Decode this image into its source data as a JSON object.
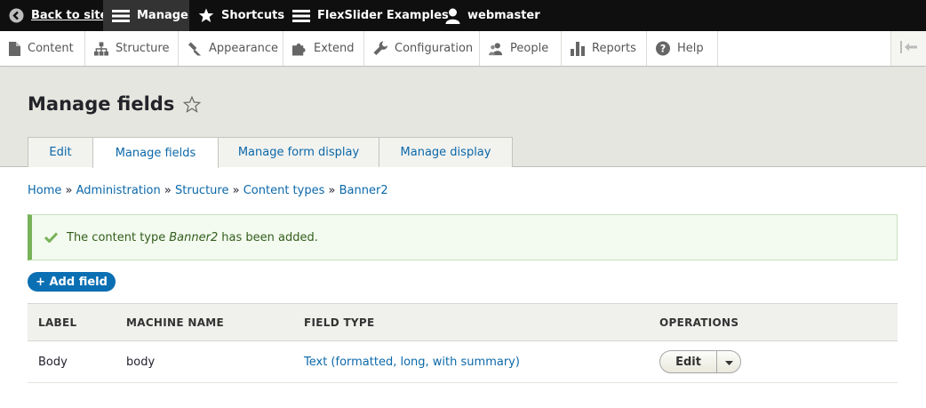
{
  "toolbar": {
    "back_to_site": "Back to site",
    "manage": "Manage",
    "shortcuts": "Shortcuts",
    "flexslider": "FlexSlider Examples",
    "user": "webmaster"
  },
  "tray": {
    "items": [
      {
        "label": "Content",
        "icon": "file-icon"
      },
      {
        "label": "Structure",
        "icon": "structure-icon"
      },
      {
        "label": "Appearance",
        "icon": "brush-icon"
      },
      {
        "label": "Extend",
        "icon": "puzzle-icon"
      },
      {
        "label": "Configuration",
        "icon": "wrench-icon"
      },
      {
        "label": "People",
        "icon": "people-icon"
      },
      {
        "label": "Reports",
        "icon": "bar-chart-icon"
      },
      {
        "label": "Help",
        "icon": "help-icon"
      }
    ]
  },
  "header": {
    "title": "Manage fields"
  },
  "tabs": [
    {
      "label": "Edit",
      "active": false
    },
    {
      "label": "Manage fields",
      "active": true
    },
    {
      "label": "Manage form display",
      "active": false
    },
    {
      "label": "Manage display",
      "active": false
    }
  ],
  "breadcrumb": {
    "items": [
      "Home",
      "Administration",
      "Structure",
      "Content types",
      "Banner2"
    ],
    "separator": "»"
  },
  "message": {
    "prefix": "The content type",
    "name": "Banner2",
    "suffix": "has been added."
  },
  "add_field": "+ Add field",
  "table": {
    "headers": [
      "LABEL",
      "MACHINE NAME",
      "FIELD TYPE",
      "OPERATIONS"
    ],
    "rows": [
      {
        "label": "Body",
        "machine_name": "body",
        "field_type": "Text (formatted, long, with summary)",
        "operation": "Edit"
      }
    ]
  },
  "colors": {
    "toolbar_bg": "#0f0f0f",
    "link": "#0b68a9",
    "status_green": "#77b259",
    "primary_button": "#0b6fb3"
  }
}
